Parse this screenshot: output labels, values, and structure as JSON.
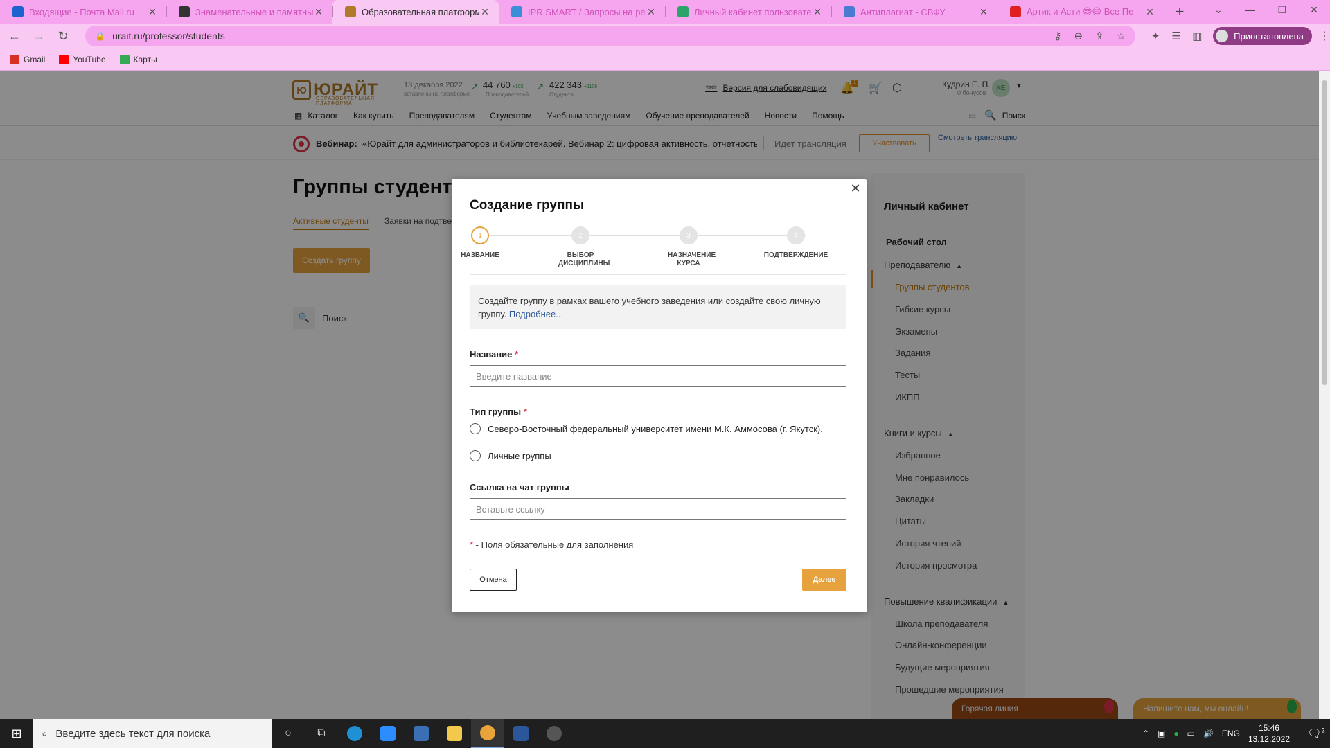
{
  "browser": {
    "tabs": [
      {
        "label": "Входящие - Почта Mail.ru",
        "favicon_color": "#1e62d0",
        "active": false
      },
      {
        "label": "Знаменательные и памятные д",
        "favicon_color": "#333333",
        "active": false
      },
      {
        "label": "Образовательная платформа Ю",
        "favicon_color": "#b07a2a",
        "active": true
      },
      {
        "label": "IPR SMART / Запросы на регис",
        "favicon_color": "#3a8fd8",
        "active": false
      },
      {
        "label": "Личный кабинет пользовател",
        "favicon_color": "#2ba36a",
        "active": false
      },
      {
        "label": "Антиплагиат - СВФУ",
        "favicon_color": "#4a7bd0",
        "active": false
      },
      {
        "label": "Артик и Асти 😎😄 Все Пе",
        "favicon_color": "#e02020",
        "active": false
      }
    ],
    "url": "urait.ru/professor/students",
    "profile_label": "Приостановлена",
    "bookmarks": [
      {
        "label": "Gmail",
        "color": "#d93025"
      },
      {
        "label": "YouTube",
        "color": "#ff0000"
      },
      {
        "label": "Карты",
        "color": "#34a853"
      }
    ]
  },
  "site": {
    "logo_text": "ЮРАЙТ",
    "logo_sub": "ОБРАЗОВАТЕЛЬНАЯ ПЛАТФОРМА",
    "date": "13 декабря 2022",
    "date_sub": "вставлены на платформе",
    "stat_teachers": {
      "value": "44 760",
      "delta": "+102",
      "label": "Преподавателей"
    },
    "stat_students": {
      "value": "422 343",
      "delta": "+1106",
      "label": "Студента"
    },
    "low_vision": "Версия для слабовидящих",
    "bell_count": "1",
    "user_name": "Кудрин Е. П.",
    "user_bonus": "0 бонусов",
    "user_initials": "КЕ",
    "nav": [
      "Каталог",
      "Как купить",
      "Преподавателям",
      "Студентам",
      "Учебным заведениям",
      "Обучение преподавателей",
      "Новости",
      "Помощь"
    ],
    "search_label": "Поиск"
  },
  "webinar": {
    "label": "Вебинар:",
    "link": "«Юрайт для администраторов и библиотекарей. Вебинар 2: цифровая активность, отчетность,",
    "status": "Идет трансляция",
    "join": "Участвовать",
    "watch": "Смотреть трансляцию"
  },
  "main": {
    "title": "Группы студентов",
    "subtabs": [
      "Активные студенты",
      "Заявки на подтверждение"
    ],
    "create_button": "Создать группу",
    "search_placeholder": "Поиск"
  },
  "sidebar": {
    "title": "Личный кабинет",
    "desk": "Рабочий стол",
    "sections": [
      {
        "label": "Преподавателю",
        "items": [
          "Группы студентов",
          "Гибкие курсы",
          "Экзамены",
          "Задания",
          "Тесты",
          "ИКПП"
        ]
      },
      {
        "label": "Книги и курсы",
        "items": [
          "Избранное",
          "Мне понравилось",
          "Закладки",
          "Цитаты",
          "История чтений",
          "История просмотра"
        ]
      },
      {
        "label": "Повышение квалификации",
        "items": [
          "Школа преподавателя",
          "Онлайн-конференции",
          "Будущие мероприятия",
          "Прошедшие мероприятия"
        ]
      }
    ],
    "active_item": "Группы студентов"
  },
  "modal": {
    "title": "Создание группы",
    "steps": [
      {
        "num": "1",
        "label": "Название"
      },
      {
        "num": "2",
        "label": "Выбор дисциплины"
      },
      {
        "num": "3",
        "label": "Назначение курса"
      },
      {
        "num": "4",
        "label": "Подтверждение"
      }
    ],
    "info_text": "Создайте группу в рамках вашего учебного заведения или создайте свою личную группу.",
    "info_more": "Подробнее...",
    "name_label": "Название",
    "name_placeholder": "Введите название",
    "type_label": "Тип группы",
    "type_options": [
      "Северо-Восточный федеральный университет имени М.К. Аммосова (г. Якутск).",
      "Личные группы"
    ],
    "chat_label": "Ссылка на чат группы",
    "chat_placeholder": "Вставьте ссылку",
    "required_star": "*",
    "required_note": " - Поля обязательные для заполнения",
    "cancel": "Отмена",
    "next": "Далее"
  },
  "chat_widgets": {
    "hotline": "Горячая линия",
    "online": "Напишите нам, мы онлайн!"
  },
  "taskbar": {
    "search_placeholder": "Введите здесь текст для поиска",
    "lang": "ENG",
    "time": "15:46",
    "date": "13.12.2022",
    "notifications": "2"
  },
  "colors": {
    "accent": "#e6a23c",
    "brand": "#b07a2a",
    "chrome_tab": "#f6a6ef"
  }
}
